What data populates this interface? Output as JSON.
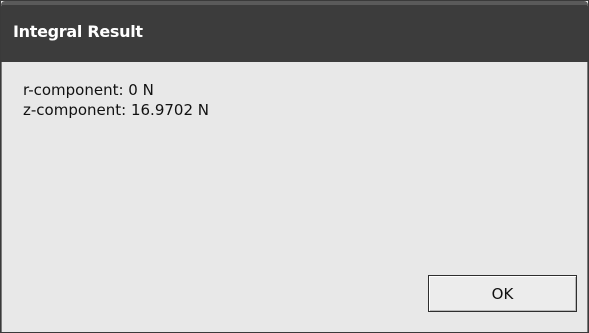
{
  "window": {
    "title": "Integral Result"
  },
  "results": [
    "r-component: 0 N",
    "z-component: 16.9702 N"
  ],
  "buttons": {
    "ok_label": "OK"
  },
  "colors": {
    "titlebar": "#3c3c3c",
    "title_text": "#ffffff",
    "dialog_background": "#e8e8e8"
  }
}
